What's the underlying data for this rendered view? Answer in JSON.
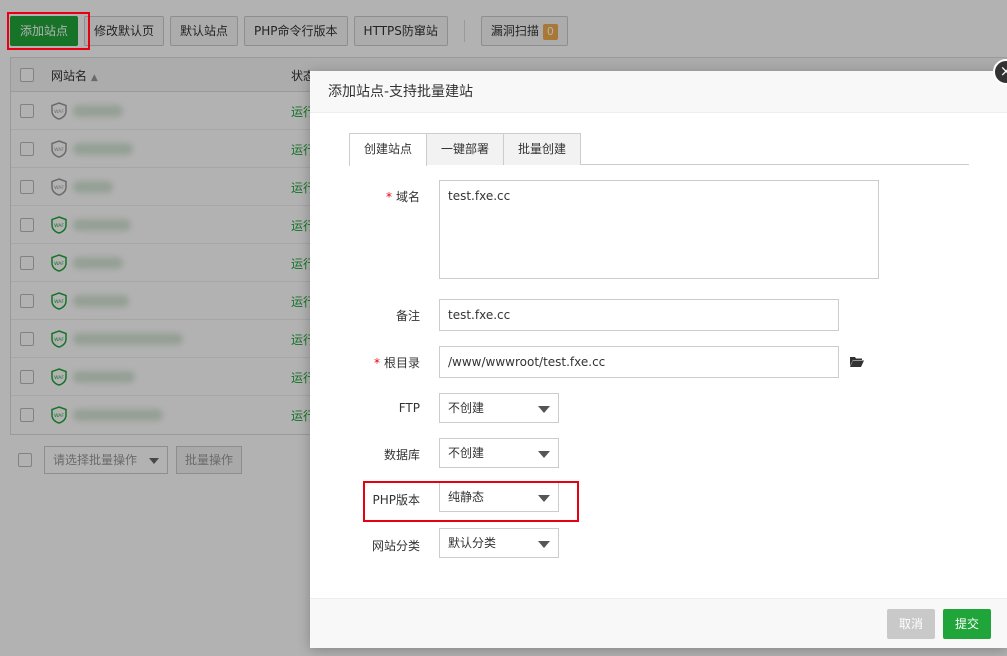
{
  "toolbar": {
    "add_site": "添加站点",
    "modify_default_page": "修改默认页",
    "default_site": "默认站点",
    "php_cli_version": "PHP命令行版本",
    "https_anti_site": "HTTPS防窜站",
    "vuln_scan": "漏洞扫描",
    "vuln_count": "0"
  },
  "table": {
    "col_site_name": "网站名",
    "col_status": "状态",
    "status_running": "运行",
    "waf_label": "WAF"
  },
  "batch": {
    "select_placeholder": "请选择批量操作",
    "apply_label": "批量操作"
  },
  "modal": {
    "title": "添加站点-支持批量建站",
    "close": "×",
    "tabs": [
      "创建站点",
      "一键部署",
      "批量创建"
    ],
    "form": {
      "domain_label": "域名",
      "domain_value": "test.fxe.cc",
      "remark_label": "备注",
      "remark_value": "test.fxe.cc",
      "root_label": "根目录",
      "root_value": "/www/wwwroot/test.fxe.cc",
      "ftp_label": "FTP",
      "ftp_value": "不创建",
      "db_label": "数据库",
      "db_value": "不创建",
      "php_label": "PHP版本",
      "php_value": "纯静态",
      "category_label": "网站分类",
      "category_value": "默认分类"
    },
    "footer": {
      "cancel": "取消",
      "submit": "提交"
    }
  },
  "colors": {
    "primary_green": "#20a53a",
    "highlight_red": "#e60012"
  }
}
